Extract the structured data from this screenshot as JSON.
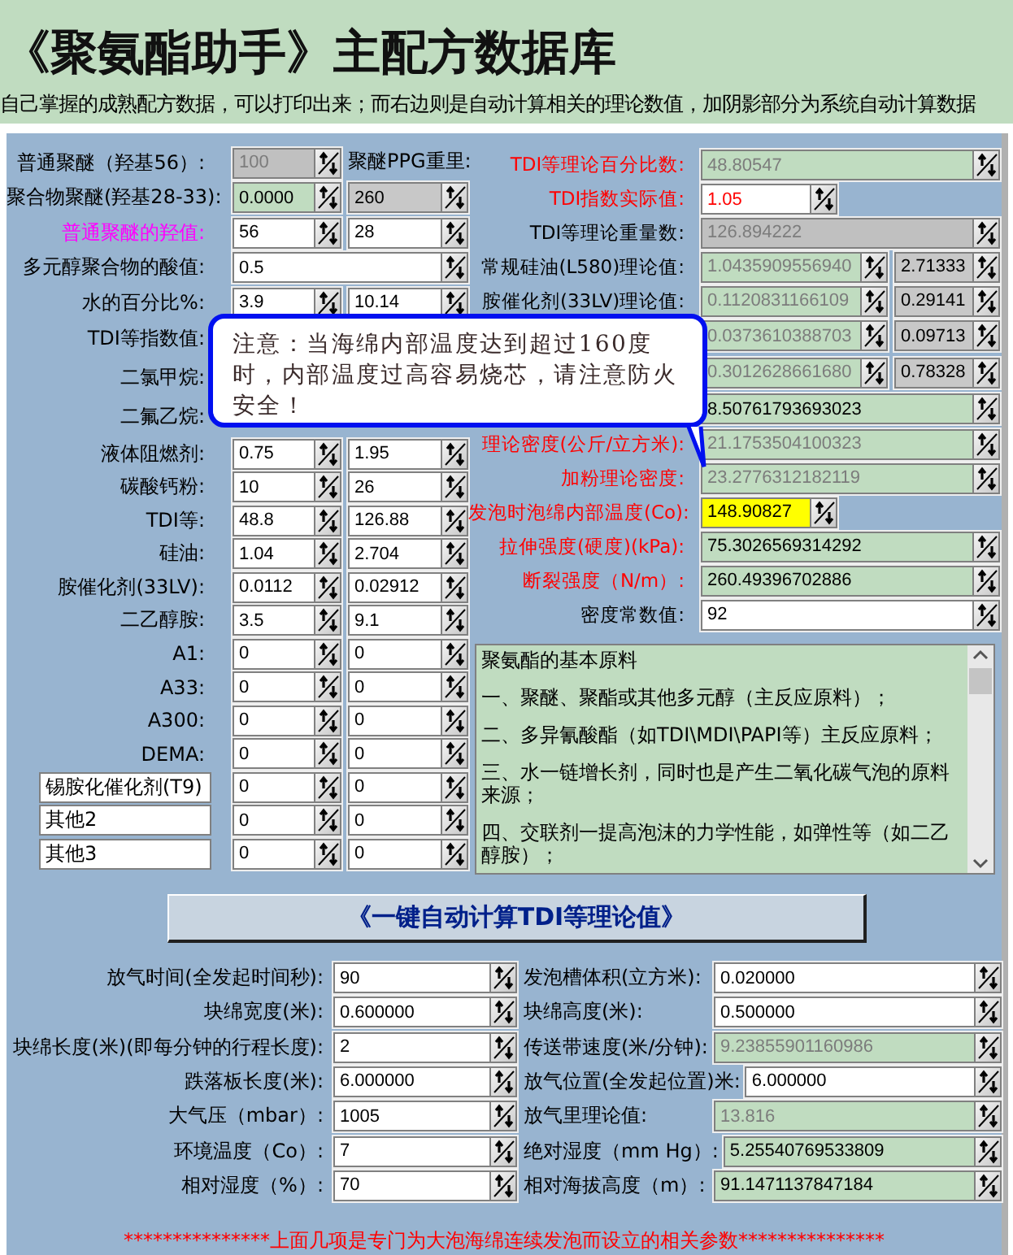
{
  "header": {
    "title": "《聚氨酯助手》主配方数据库",
    "subtitle": "自己掌握的成熟配方数据，可以打印出来；而右边则是自动计算相关的理论数值，加阴影部分为系统自动计算数据"
  },
  "left_rows": [
    {
      "kind": "plain",
      "label": "普通聚醚（羟基56）:",
      "cells": [
        {
          "kind": "disabled",
          "value": "100"
        },
        {
          "kind": "text",
          "text": "聚醚PPG重里:"
        }
      ]
    },
    {
      "kind": "plain",
      "label": "聚合物聚醚(羟基28-33):",
      "cells": [
        {
          "kind": "result",
          "value": "0.0000"
        },
        {
          "kind": "readonly",
          "value": "260"
        }
      ]
    },
    {
      "kind": "accent",
      "label": "普通聚醚的羟值:",
      "cells": [
        {
          "kind": "input",
          "value": "56"
        },
        {
          "kind": "input",
          "value": "28"
        }
      ]
    },
    {
      "kind": "plain",
      "label": "多元醇聚合物的酸值:",
      "cells": [
        {
          "kind": "input",
          "value": "0.5"
        }
      ]
    },
    {
      "kind": "plain",
      "label": "水的百分比%:",
      "cells": [
        {
          "kind": "input",
          "value": "3.9"
        },
        {
          "kind": "input",
          "value": "10.14"
        }
      ]
    },
    {
      "kind": "plain",
      "label": "TDI等指数值:"
    },
    {
      "kind": "plain",
      "label": "二氯甲烷:"
    },
    {
      "kind": "plain",
      "label": "二氟乙烷:"
    },
    {
      "kind": "plain",
      "label": "液体阻燃剂:",
      "cells": [
        {
          "kind": "input",
          "value": "0.75"
        },
        {
          "kind": "input",
          "value": "1.95"
        }
      ]
    },
    {
      "kind": "plain",
      "label": "碳酸钙粉:",
      "cells": [
        {
          "kind": "input",
          "value": "10"
        },
        {
          "kind": "input",
          "value": "26"
        }
      ]
    },
    {
      "kind": "plain",
      "label": "TDI等:",
      "cells": [
        {
          "kind": "input",
          "value": "48.8"
        },
        {
          "kind": "input",
          "value": "126.88"
        }
      ]
    },
    {
      "kind": "plain",
      "label": "硅油:",
      "cells": [
        {
          "kind": "input",
          "value": "1.04"
        },
        {
          "kind": "input",
          "value": "2.704"
        }
      ]
    },
    {
      "kind": "plain",
      "label": "胺催化剂(33LV):",
      "cells": [
        {
          "kind": "input",
          "value": "0.0112"
        },
        {
          "kind": "input",
          "value": "0.02912"
        }
      ]
    },
    {
      "kind": "plain",
      "label": "二乙醇胺:",
      "cells": [
        {
          "kind": "input",
          "value": "3.5"
        },
        {
          "kind": "input",
          "value": "9.1"
        }
      ]
    },
    {
      "kind": "plain",
      "label": "A1:",
      "cells": [
        {
          "kind": "input",
          "value": "0"
        },
        {
          "kind": "input",
          "value": "0"
        }
      ]
    },
    {
      "kind": "plain",
      "label": "A33:",
      "cells": [
        {
          "kind": "input",
          "value": "0"
        },
        {
          "kind": "input",
          "value": "0"
        }
      ]
    },
    {
      "kind": "plain",
      "label": "A300:",
      "cells": [
        {
          "kind": "input",
          "value": "0"
        },
        {
          "kind": "input",
          "value": "0"
        }
      ]
    },
    {
      "kind": "plain",
      "label": "DEMA:",
      "cells": [
        {
          "kind": "input",
          "value": "0"
        },
        {
          "kind": "input",
          "value": "0"
        }
      ]
    },
    {
      "kind": "named",
      "label": "锡胺化催化剂(T9)",
      "cells": [
        {
          "kind": "input",
          "value": "0"
        },
        {
          "kind": "input",
          "value": "0"
        }
      ]
    },
    {
      "kind": "named",
      "label": "其他2",
      "cells": [
        {
          "kind": "input",
          "value": "0"
        },
        {
          "kind": "input",
          "value": "0"
        }
      ]
    },
    {
      "kind": "named",
      "label": "其他3",
      "cells": [
        {
          "kind": "input",
          "value": "0"
        },
        {
          "kind": "input",
          "value": "0"
        }
      ]
    }
  ],
  "right_rows": [
    {
      "kind": "alert",
      "label": "TDI等理论百分比数:",
      "cells": [
        {
          "kind": "computed",
          "value": "48.80547"
        }
      ]
    },
    {
      "kind": "alert",
      "label": "TDI指数实际值:",
      "cells": [
        {
          "kind": "alert",
          "value": "1.05"
        }
      ]
    },
    {
      "kind": "plain",
      "label": "TDI等理论重量数:",
      "cells": [
        {
          "kind": "disabled",
          "value": "126.894222"
        }
      ]
    },
    {
      "kind": "plain",
      "label": "常规硅油(L580)理论值:",
      "cells": [
        {
          "kind": "computed",
          "value": "1.0435909556940"
        },
        {
          "kind": "readonly",
          "value": "2.71333"
        }
      ]
    },
    {
      "kind": "plain",
      "label": "胺催化剂(33LV)理论值:",
      "cells": [
        {
          "kind": "computed",
          "value": "0.1120831166109"
        },
        {
          "kind": "readonly",
          "value": "0.29141"
        }
      ]
    },
    {
      "cells": [
        {
          "kind": "computed",
          "value": "0.0373610388703"
        },
        {
          "kind": "readonly",
          "value": "0.09713"
        }
      ]
    },
    {
      "cells": [
        {
          "kind": "computed",
          "value": "0.3012628661680"
        },
        {
          "kind": "readonly",
          "value": "0.78328"
        }
      ]
    },
    {
      "cells": [
        {
          "kind": "result",
          "value": "8.50761793693023"
        }
      ]
    },
    {
      "kind": "alert",
      "label": "理论密度(公斤/立方米):",
      "cells": [
        {
          "kind": "computed",
          "value": "21.1753504100323"
        }
      ]
    },
    {
      "kind": "alert",
      "label": "加粉理论密度:",
      "cells": [
        {
          "kind": "computed",
          "value": "23.2776312182119"
        }
      ]
    },
    {
      "kind": "alert",
      "label": "发泡时泡绵内部温度(Co):",
      "cells": [
        {
          "kind": "warning",
          "value": "148.90827"
        }
      ]
    },
    {
      "kind": "alert",
      "label": "拉伸强度(硬度)(kPa):",
      "cells": [
        {
          "kind": "result",
          "value": "75.3026569314292"
        }
      ]
    },
    {
      "kind": "alert",
      "label": "断裂强度（N/m）:",
      "cells": [
        {
          "kind": "result",
          "value": "260.49396702886"
        }
      ]
    },
    {
      "kind": "plain",
      "label": "密度常数值:",
      "cells": [
        {
          "kind": "input",
          "value": "92"
        }
      ]
    }
  ],
  "notes": {
    "paragraphs": [
      "聚氨酯的基本原料",
      "一、聚醚、聚酯或其他多元醇（主反应原料）；",
      "二、多异氰酸酯（如TDI\\MDI\\PAPI等）主反应原料；",
      "三、水一链增长剂，同时也是产生二氧化碳气泡的原料来源；",
      "四、交联剂一提高泡沫的力学性能，如弹性等（如二乙醇胺）；"
    ]
  },
  "calc_button": "《一键自动计算TDI等理论值》",
  "foam_rows": [
    {
      "left": {
        "label": "放气时间(全发起时间秒):",
        "field": {
          "kind": "input",
          "value": "90"
        }
      },
      "right": {
        "label": "发泡槽体积(立方米):",
        "field": {
          "kind": "input",
          "value": "0.020000"
        }
      }
    },
    {
      "left": {
        "label": "块绵宽度(米):",
        "field": {
          "kind": "input",
          "value": "0.600000"
        }
      },
      "right": {
        "label": "块绵高度(米):",
        "field": {
          "kind": "input",
          "value": "0.500000"
        }
      }
    },
    {
      "left": {
        "label": "块绵长度(米)(即每分钟的行程长度):",
        "field": {
          "kind": "input",
          "value": "2"
        }
      },
      "right": {
        "label": "传送带速度(米/分钟):",
        "field": {
          "kind": "computed",
          "value": "9.23855901160986"
        }
      }
    },
    {
      "left": {
        "label": "跌落板长度(米):",
        "field": {
          "kind": "input",
          "value": "6.000000"
        }
      },
      "right": {
        "label": "放气位置(全发起位置)米:",
        "field": {
          "kind": "input",
          "value": "6.000000"
        }
      }
    },
    {
      "left": {
        "label": "大气压（mbar）:",
        "field": {
          "kind": "input",
          "value": "1005"
        }
      },
      "right": {
        "label": "放气里理论值:",
        "field": {
          "kind": "computed",
          "value": "13.816"
        }
      }
    },
    {
      "left": {
        "label": "环境温度（Co）:",
        "field": {
          "kind": "input",
          "value": "7"
        }
      },
      "right": {
        "label": "绝对湿度（mm Hg）:",
        "field": {
          "kind": "result",
          "value": "5.25540769533809"
        }
      }
    },
    {
      "left": {
        "label": "相对湿度（%）:",
        "field": {
          "kind": "input",
          "value": "70"
        }
      },
      "right": {
        "label": "相对海拔高度（m）:",
        "field": {
          "kind": "result",
          "value": "91.1471137847184"
        }
      }
    }
  ],
  "footer": "***************上面几项是专门为大泡海绵连续发泡而设立的相关参数***************",
  "callout": "注意：当海绵内部温度达到超过160度时，内部温度过高容易烧芯，请注意防火安全！"
}
